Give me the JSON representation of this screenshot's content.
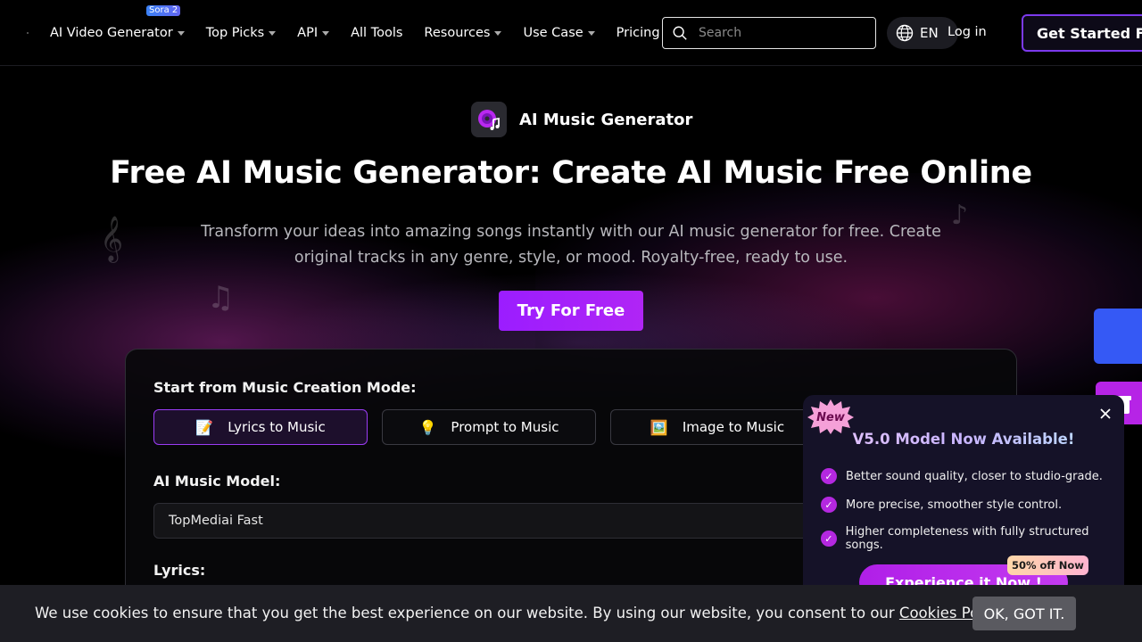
{
  "header": {
    "nav": [
      {
        "label": "AI Video Generator",
        "caret": true
      },
      {
        "label": "Top Picks",
        "caret": true
      },
      {
        "label": "API",
        "caret": true
      },
      {
        "label": "All Tools",
        "caret": false
      },
      {
        "label": "Resources",
        "caret": true
      },
      {
        "label": "Use Case",
        "caret": true
      },
      {
        "label": "Pricing",
        "caret": false
      }
    ],
    "sora_badge": "Sora 2",
    "search_placeholder": "Search",
    "language": "EN",
    "login": "Log in",
    "get_started": "Get Started Free"
  },
  "hero": {
    "app_name": "AI Music Generator",
    "title": "Free AI Music Generator: Create AI Music Free Online",
    "subtitle": "Transform your ideas into amazing songs instantly with our AI music generator for free. Create original tracks in any genre, style, or mood. Royalty-free, ready to use.",
    "cta": "Try For Free"
  },
  "creator": {
    "mode_label": "Start from Music Creation Mode:",
    "modes": [
      {
        "label": "Lyrics to Music",
        "emoji": "📝",
        "active": true
      },
      {
        "label": "Prompt to Music",
        "emoji": "💡",
        "active": false
      },
      {
        "label": "Image to Music",
        "emoji": "🖼️",
        "active": false
      }
    ],
    "model_label": "AI Music Model:",
    "model_value": "TopMediai Fast",
    "lyrics_label": "Lyrics:"
  },
  "popup": {
    "new_badge": "New",
    "title": "V5.0 Model Now Available!",
    "features": [
      "Better sound quality, closer to studio-grade.",
      "More precise, smoother style control.",
      "Higher completeness with fully structured songs."
    ],
    "button": "Experience it Now !",
    "discount": "50% off Now"
  },
  "cookie": {
    "text": "We use cookies to ensure that you get the best experience on our website. By using our website, you consent to our ",
    "link": "Cookies Policy",
    "period": ".",
    "button": "OK, GOT IT."
  },
  "colors": {
    "accent": "#9b1dff",
    "popup_bg": "#151228",
    "side_blue": "#3559f5",
    "side_purple": "#b624e6"
  }
}
